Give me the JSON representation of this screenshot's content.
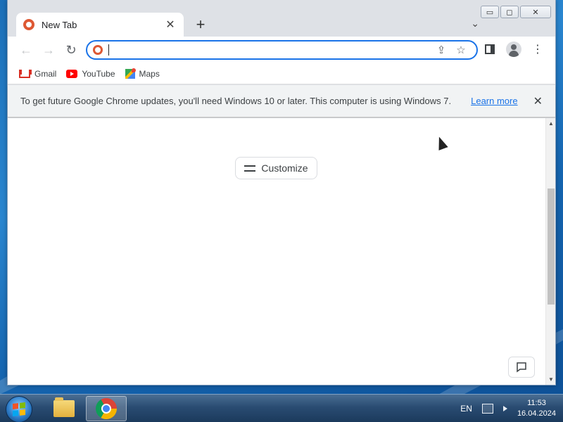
{
  "window": {
    "controls": {
      "minimize": "▭",
      "maximize": "◻",
      "close": "✕"
    }
  },
  "tabs": [
    {
      "title": "New Tab",
      "favicon": "duckduckgo-icon",
      "close": "✕"
    }
  ],
  "tabstrip": {
    "new_tab": "+",
    "tab_search": "⌄"
  },
  "toolbar": {
    "back": "←",
    "forward": "→",
    "reload": "↻",
    "omnibox": {
      "value": "",
      "placeholder": ""
    },
    "share": "⇪",
    "bookmark_star": "☆",
    "menu": "⋮"
  },
  "bookmarks": [
    {
      "label": "Gmail",
      "icon": "gmail-icon"
    },
    {
      "label": "YouTube",
      "icon": "youtube-icon"
    },
    {
      "label": "Maps",
      "icon": "maps-icon"
    }
  ],
  "infobar": {
    "message": "To get future Google Chrome updates, you'll need Windows 10 or later. This computer is using Windows 7.",
    "link": "Learn more",
    "close": "✕"
  },
  "ntp": {
    "customize_label": "Customize"
  },
  "scrollbar": {
    "up": "▲",
    "down": "▼"
  },
  "taskbar": {
    "language": "EN",
    "time": "11:53",
    "date": "16.04.2024"
  },
  "colors": {
    "accent": "#1a73e8",
    "tab_strip": "#dee1e6",
    "infobar": "#f1f3f4"
  }
}
